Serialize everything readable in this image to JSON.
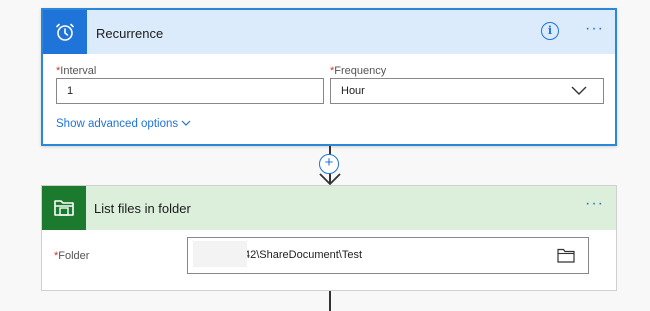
{
  "recurrence": {
    "title": "Recurrence",
    "interval_label": "Interval",
    "interval_value": "1",
    "frequency_label": "Frequency",
    "frequency_value": "Hour",
    "show_advanced": "Show advanced options",
    "required_marker": "*",
    "more_label": "···"
  },
  "list_files": {
    "title": "List files in folder",
    "folder_label": "Folder",
    "folder_value": "42\\ShareDocument\\Test",
    "required_marker": "*",
    "more_label": "···"
  },
  "info_glyph": "i",
  "add_glyph": "+",
  "colors": {
    "accent_blue": "#1e74d8",
    "recurrence_header": "#dcebfb",
    "sharepoint_green": "#1b7a2e",
    "listfiles_header": "#dbefdb",
    "required_red": "#d13438"
  },
  "icons": [
    "alarm-clock-icon",
    "info-icon",
    "more-icon",
    "chevron-down-icon",
    "plus-icon",
    "sharepoint-icon",
    "folder-icon"
  ]
}
